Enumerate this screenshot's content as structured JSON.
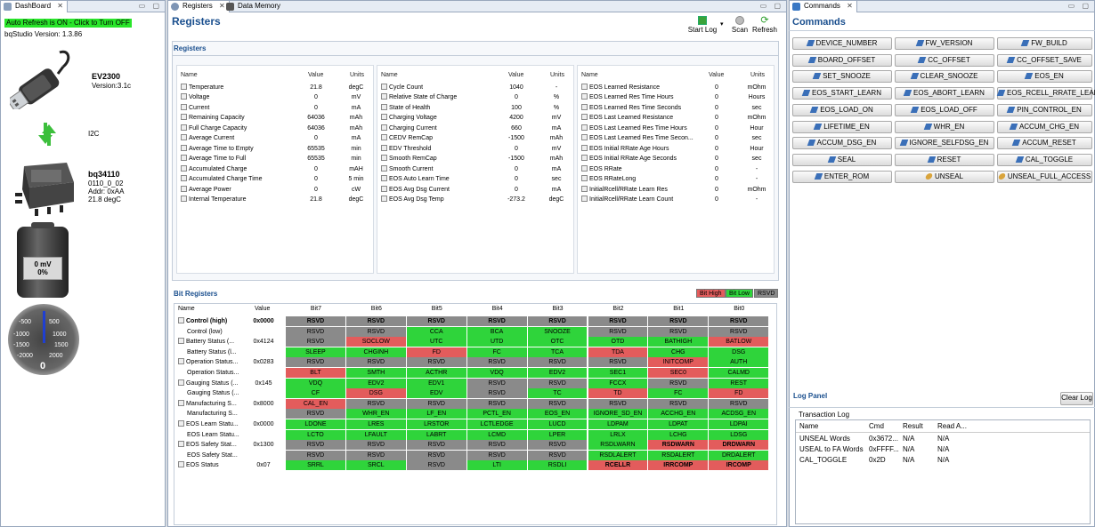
{
  "dashboard": {
    "tab_label": "DashBoard",
    "auto_refresh": "Auto Refresh is ON - Click to Turn OFF",
    "version": "bqStudio Version: 1.3.86",
    "board_name": "EV2300",
    "board_version": "Version:3.1c",
    "interface": "I2C",
    "device_name": "bq34110",
    "device_fw": "0110_0_02",
    "device_addr": "Addr: 0xAA",
    "device_temp": "21.8 degC",
    "battery_voltage": "0 mV",
    "battery_percent": "0%",
    "gauge_ticks": [
      "-500",
      "500",
      "-1000",
      "1000",
      "-1500",
      "1500",
      "-2000",
      "2000"
    ],
    "gauge_value": "0"
  },
  "middle": {
    "tabs": [
      "Registers",
      "Data Memory"
    ],
    "title": "Registers",
    "toolbar": {
      "start_log": "Start Log",
      "scan": "Scan",
      "refresh": "Refresh"
    },
    "registers_section": "Registers",
    "col_headers": {
      "name": "Name",
      "value": "Value",
      "units": "Units"
    },
    "columns": [
      [
        {
          "name": "Temperature",
          "value": "21.8",
          "units": "degC"
        },
        {
          "name": "Voltage",
          "value": "0",
          "units": "mV"
        },
        {
          "name": "Current",
          "value": "0",
          "units": "mA"
        },
        {
          "name": "Remaining Capacity",
          "value": "64036",
          "units": "mAh"
        },
        {
          "name": "Full Charge Capacity",
          "value": "64036",
          "units": "mAh"
        },
        {
          "name": "Average Current",
          "value": "0",
          "units": "mA"
        },
        {
          "name": "Average Time to Empty",
          "value": "65535",
          "units": "min"
        },
        {
          "name": "Average Time to Full",
          "value": "65535",
          "units": "min"
        },
        {
          "name": "Accumulated Charge",
          "value": "0",
          "units": "mAH"
        },
        {
          "name": "Accumulated Charge Time",
          "value": "0",
          "units": "5 min"
        },
        {
          "name": "Average Power",
          "value": "0",
          "units": "cW"
        },
        {
          "name": "Internal Temperature",
          "value": "21.8",
          "units": "degC"
        }
      ],
      [
        {
          "name": "Cycle Count",
          "value": "1040",
          "units": "-"
        },
        {
          "name": "Relative State of Charge",
          "value": "0",
          "units": "%"
        },
        {
          "name": "State of Health",
          "value": "100",
          "units": "%"
        },
        {
          "name": "Charging Voltage",
          "value": "4200",
          "units": "mV"
        },
        {
          "name": "Charging Current",
          "value": "660",
          "units": "mA"
        },
        {
          "name": "CEDV RemCap",
          "value": "-1500",
          "units": "mAh"
        },
        {
          "name": "EDV Threshold",
          "value": "0",
          "units": "mV"
        },
        {
          "name": "Smooth RemCap",
          "value": "-1500",
          "units": "mAh"
        },
        {
          "name": "Smooth Current",
          "value": "0",
          "units": "mA"
        },
        {
          "name": "EOS Auto Learn Time",
          "value": "0",
          "units": "sec"
        },
        {
          "name": "EOS Avg Dsg Current",
          "value": "0",
          "units": "mA"
        },
        {
          "name": "EOS Avg Dsg Temp",
          "value": "-273.2",
          "units": "degC"
        }
      ],
      [
        {
          "name": "EOS Learned Resistance",
          "value": "0",
          "units": "mOhm"
        },
        {
          "name": "EOS Learned Res Time Hours",
          "value": "0",
          "units": "Hours"
        },
        {
          "name": "EOS Learned Res Time Seconds",
          "value": "0",
          "units": "sec"
        },
        {
          "name": "EOS Last Learned Resistance",
          "value": "0",
          "units": "mOhm"
        },
        {
          "name": "EOS Last Learned Res Time Hours",
          "value": "0",
          "units": "Hour"
        },
        {
          "name": "EOS Last Learned Res Time Secon...",
          "value": "0",
          "units": "sec"
        },
        {
          "name": "EOS Initial RRate Age Hours",
          "value": "0",
          "units": "Hour"
        },
        {
          "name": "EOS Initial RRate Age Seconds",
          "value": "0",
          "units": "sec"
        },
        {
          "name": "EOS RRate",
          "value": "0",
          "units": "-"
        },
        {
          "name": "EOS RRateLong",
          "value": "0",
          "units": "-"
        },
        {
          "name": "InitialRcell/RRate Learn Res",
          "value": "0",
          "units": "mOhm"
        },
        {
          "name": "InitialRcell/RRate Learn Count",
          "value": "0",
          "units": "-"
        }
      ]
    ],
    "bit_section": "Bit Registers",
    "legend": {
      "high": "Bit High",
      "low": "Bit Low",
      "rsvd": "RSVD"
    },
    "bit_headers": [
      "Name",
      "Value",
      "Bit7",
      "Bit6",
      "Bit5",
      "Bit4",
      "Bit3",
      "Bit2",
      "Bit1",
      "Bit0"
    ],
    "bit_rows": [
      {
        "name": "Control (high)",
        "value": "0x0000",
        "icon": "edit",
        "bold": true,
        "bits": [
          [
            "RSVD",
            "y"
          ],
          [
            "RSVD",
            "y"
          ],
          [
            "RSVD",
            "y"
          ],
          [
            "RSVD",
            "y"
          ],
          [
            "RSVD",
            "y"
          ],
          [
            "RSVD",
            "y"
          ],
          [
            "RSVD",
            "y"
          ],
          [
            "RSVD",
            "y"
          ]
        ]
      },
      {
        "name": "Control (low)",
        "value": "",
        "icon": "",
        "bold": false,
        "bits": [
          [
            "RSVD",
            "y"
          ],
          [
            "RSVD",
            "y"
          ],
          [
            "CCA",
            "g"
          ],
          [
            "BCA",
            "g"
          ],
          [
            "SNOOZE",
            "g"
          ],
          [
            "RSVD",
            "y"
          ],
          [
            "RSVD",
            "y"
          ],
          [
            "RSVD",
            "y"
          ]
        ]
      },
      {
        "name": "Battery Status (...",
        "value": "0x4124",
        "icon": "edit",
        "bold": false,
        "bits": [
          [
            "RSVD",
            "y"
          ],
          [
            "SOCLOW",
            "r"
          ],
          [
            "UTC",
            "g"
          ],
          [
            "UTD",
            "g"
          ],
          [
            "OTC",
            "g"
          ],
          [
            "OTD",
            "g"
          ],
          [
            "BATHIGH",
            "g"
          ],
          [
            "BATLOW",
            "r"
          ]
        ]
      },
      {
        "name": "Battery Status (l...",
        "value": "",
        "icon": "",
        "bold": false,
        "bits": [
          [
            "SLEEP",
            "g"
          ],
          [
            "CHGINH",
            "g"
          ],
          [
            "FD",
            "r"
          ],
          [
            "FC",
            "g"
          ],
          [
            "TCA",
            "g"
          ],
          [
            "TDA",
            "r"
          ],
          [
            "CHG",
            "g"
          ],
          [
            "DSG",
            "g"
          ]
        ]
      },
      {
        "name": "Operation Status...",
        "value": "0x0283",
        "icon": "edit",
        "bold": false,
        "bits": [
          [
            "RSVD",
            "y"
          ],
          [
            "RSVD",
            "y"
          ],
          [
            "RSVD",
            "y"
          ],
          [
            "RSVD",
            "y"
          ],
          [
            "RSVD",
            "y"
          ],
          [
            "RSVD",
            "y"
          ],
          [
            "INITCOMP",
            "r"
          ],
          [
            "AUTH",
            "g"
          ]
        ]
      },
      {
        "name": "Operation Status...",
        "value": "",
        "icon": "",
        "bold": false,
        "bits": [
          [
            "BLT",
            "r"
          ],
          [
            "SMTH",
            "g"
          ],
          [
            "ACTHR",
            "g"
          ],
          [
            "VDQ",
            "g"
          ],
          [
            "EDV2",
            "g"
          ],
          [
            "SEC1",
            "g"
          ],
          [
            "SEC0",
            "r"
          ],
          [
            "CALMD",
            "g"
          ]
        ]
      },
      {
        "name": "Gauging Status (...",
        "value": "0x145",
        "icon": "box",
        "bold": false,
        "bits": [
          [
            "VDQ",
            "g"
          ],
          [
            "EDV2",
            "g"
          ],
          [
            "EDV1",
            "g"
          ],
          [
            "RSVD",
            "y"
          ],
          [
            "RSVD",
            "y"
          ],
          [
            "FCCX",
            "g"
          ],
          [
            "RSVD",
            "y"
          ],
          [
            "REST",
            "g"
          ]
        ]
      },
      {
        "name": "Gauging Status (...",
        "value": "",
        "icon": "",
        "bold": false,
        "bits": [
          [
            "CF",
            "g"
          ],
          [
            "DSG",
            "r"
          ],
          [
            "EDV",
            "g"
          ],
          [
            "RSVD",
            "y"
          ],
          [
            "TC",
            "g"
          ],
          [
            "TD",
            "r"
          ],
          [
            "FC",
            "g"
          ],
          [
            "FD",
            "r"
          ]
        ]
      },
      {
        "name": "Manufacturing S...",
        "value": "0x8000",
        "icon": "box",
        "bold": false,
        "bits": [
          [
            "CAL_EN",
            "r"
          ],
          [
            "RSVD",
            "y"
          ],
          [
            "RSVD",
            "y"
          ],
          [
            "RSVD",
            "y"
          ],
          [
            "RSVD",
            "y"
          ],
          [
            "RSVD",
            "y"
          ],
          [
            "RSVD",
            "y"
          ],
          [
            "RSVD",
            "y"
          ]
        ]
      },
      {
        "name": "Manufacturing S...",
        "value": "",
        "icon": "",
        "bold": false,
        "bits": [
          [
            "RSVD",
            "y"
          ],
          [
            "WHR_EN",
            "g"
          ],
          [
            "LF_EN",
            "g"
          ],
          [
            "PCTL_EN",
            "g"
          ],
          [
            "EOS_EN",
            "g"
          ],
          [
            "IGNORE_SD_EN",
            "g"
          ],
          [
            "ACCHG_EN",
            "g"
          ],
          [
            "ACDSG_EN",
            "g"
          ]
        ]
      },
      {
        "name": "EOS Learn Statu...",
        "value": "0x0000",
        "icon": "edit",
        "bold": false,
        "bits": [
          [
            "LDONE",
            "g"
          ],
          [
            "LRES",
            "g"
          ],
          [
            "LRSTOR",
            "g"
          ],
          [
            "LCTLEDGE",
            "g"
          ],
          [
            "LUCD",
            "g"
          ],
          [
            "LDPAM",
            "g"
          ],
          [
            "LDPAT",
            "g"
          ],
          [
            "LDPAI",
            "g"
          ]
        ]
      },
      {
        "name": "EOS Learn Statu...",
        "value": "",
        "icon": "",
        "bold": false,
        "bits": [
          [
            "LCTO",
            "g"
          ],
          [
            "LFAULT",
            "g"
          ],
          [
            "LABRT",
            "g"
          ],
          [
            "LCMD",
            "g"
          ],
          [
            "LPER",
            "g"
          ],
          [
            "LRLX",
            "g"
          ],
          [
            "LCHG",
            "g"
          ],
          [
            "LDSG",
            "g"
          ]
        ]
      },
      {
        "name": "EOS Safety Stat...",
        "value": "0x1300",
        "icon": "box",
        "bold": false,
        "bits": [
          [
            "RSVD",
            "y"
          ],
          [
            "RSVD",
            "y"
          ],
          [
            "RSVD",
            "y"
          ],
          [
            "RSVD",
            "y"
          ],
          [
            "RSVD",
            "y"
          ],
          [
            "RSDLWARN",
            "g"
          ],
          [
            "RSDWARN",
            "r"
          ],
          [
            "DRDWARN",
            "r"
          ]
        ]
      },
      {
        "name": "EOS Safety Stat...",
        "value": "",
        "icon": "",
        "bold": false,
        "bits": [
          [
            "RSVD",
            "y"
          ],
          [
            "RSVD",
            "y"
          ],
          [
            "RSVD",
            "y"
          ],
          [
            "RSVD",
            "y"
          ],
          [
            "RSVD",
            "y"
          ],
          [
            "RSDLALERT",
            "g"
          ],
          [
            "RSDALERT",
            "g"
          ],
          [
            "DRDALERT",
            "g"
          ]
        ]
      },
      {
        "name": "EOS Status",
        "value": "0x07",
        "icon": "box",
        "bold": false,
        "bits": [
          [
            "SRRL",
            "g"
          ],
          [
            "SRCL",
            "g"
          ],
          [
            "RSVD",
            "y"
          ],
          [
            "LTI",
            "g"
          ],
          [
            "RSDLI",
            "g"
          ],
          [
            "RCELLR",
            "r"
          ],
          [
            "IRRCOMP",
            "r"
          ],
          [
            "IRCOMP",
            "r"
          ]
        ]
      }
    ]
  },
  "commands": {
    "tab_label": "Commands",
    "title": "Commands",
    "buttons": [
      "DEVICE_NUMBER",
      "FW_VERSION",
      "FW_BUILD",
      "BOARD_OFFSET",
      "CC_OFFSET",
      "CC_OFFSET_SAVE",
      "SET_SNOOZE",
      "CLEAR_SNOOZE",
      "EOS_EN",
      "EOS_START_LEARN",
      "EOS_ABORT_LEARN",
      "EOS_RCELL_RRATE_LEARN",
      "EOS_LOAD_ON",
      "EOS_LOAD_OFF",
      "PIN_CONTROL_EN",
      "LIFETIME_EN",
      "WHR_EN",
      "ACCUM_CHG_EN",
      "ACCUM_DSG_EN",
      "IGNORE_SELFDSG_EN",
      "ACCUM_RESET",
      "SEAL",
      "RESET",
      "CAL_TOGGLE",
      "ENTER_ROM",
      "UNSEAL",
      "UNSEAL_FULL_ACCESS"
    ],
    "log_panel": "Log Panel",
    "clear_log": "Clear Log",
    "transaction_log": "Transaction Log",
    "log_headers": [
      "Name",
      "Cmd",
      "Result",
      "Read A..."
    ],
    "log_rows": [
      [
        "UNSEAL Words",
        "0x3672...",
        "N/A",
        "N/A"
      ],
      [
        "USEAL to FA Words",
        "0xFFFF...",
        "N/A",
        "N/A"
      ],
      [
        "CAL_TOGGLE",
        "0x2D",
        "N/A",
        "N/A"
      ]
    ]
  },
  "colors": {
    "bit_high": "#e35c5c",
    "bit_low": "#2fd43b",
    "rsvd": "#8a8a8a",
    "accent": "#1a4f8e"
  }
}
